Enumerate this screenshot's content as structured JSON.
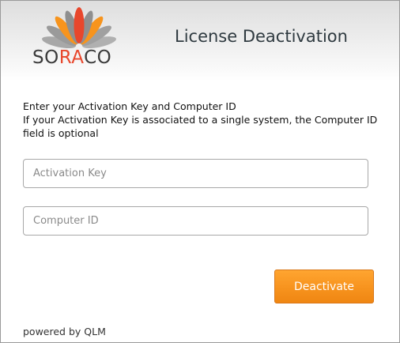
{
  "header": {
    "logo": {
      "text_pre": "SO",
      "text_accent": "RA",
      "text_post": "CO",
      "accent_color": "#e8472c",
      "petal_colors": [
        "#f7941d",
        "#e8472c",
        "#9e9e9e"
      ]
    },
    "title": "License Deactivation"
  },
  "instructions": {
    "line1": "Enter your Activation Key and Computer ID",
    "line2": "If your Activation Key is associated to a single system, the Computer ID field is optional"
  },
  "form": {
    "activation_key": {
      "value": "",
      "placeholder": "Activation Key"
    },
    "computer_id": {
      "value": "",
      "placeholder": "Computer ID"
    },
    "deactivate_label": "Deactivate",
    "button_color": "#f7931e"
  },
  "footer": {
    "text": "powered by QLM"
  }
}
